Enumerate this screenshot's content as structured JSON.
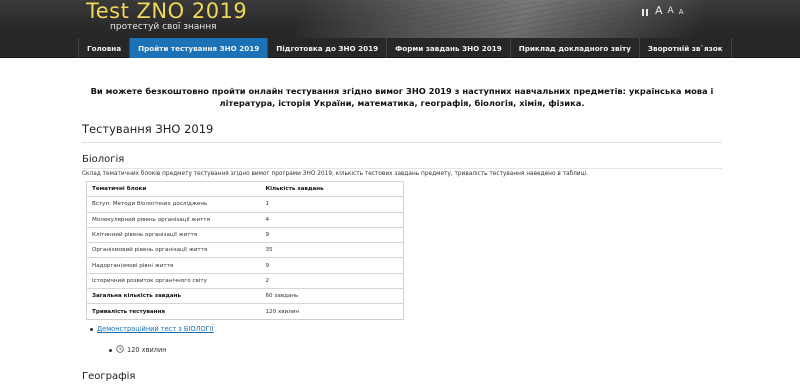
{
  "header": {
    "site_title": "Test ZNO 2019",
    "slogan": "протестуй свої знання",
    "controls": {
      "font_large": "A",
      "font_medium": "A",
      "font_small": "A"
    }
  },
  "nav": {
    "items": [
      {
        "label": "Головна"
      },
      {
        "label": "Пройти тестування ЗНО 2019",
        "active": true
      },
      {
        "label": "Підготовка до ЗНО 2019"
      },
      {
        "label": "Форми завдань ЗНО 2019"
      },
      {
        "label": "Приклад докладного звіту"
      },
      {
        "label": "Зворотній зв`язок"
      }
    ]
  },
  "main": {
    "intro": "Ви можете безкоштовно пройти онлайн тестування згідно вимог ЗНО 2019 з наступних навчальних предметів: українська мова і література, історія України, математика, географія, біологія, хімія, фізика.",
    "page_title": "Тестування ЗНО 2019",
    "sections": [
      {
        "title": "Біологія",
        "description": "Склад тематичних блоків предмету тестування згідно вимог програми ЗНО 2019, кількість тестових завдань предмету, тривалість тестування наведено в таблиці.",
        "table": {
          "headers": [
            "Тематичні блоки",
            "Кількість завдань"
          ],
          "rows": [
            [
              "Вступ. Методи біологічних досліджень",
              "1"
            ],
            [
              "Молекулярний рівень організації життя",
              "4"
            ],
            [
              "Клітинний рівень організації життя",
              "9"
            ],
            [
              "Організмовий рівень організації життя",
              "35"
            ],
            [
              "Надорганізмові рівні життя",
              "9"
            ],
            [
              "Історичний розвиток органічного світу",
              "2"
            ],
            [
              "Загальна кількість завдань",
              "60 завдань"
            ],
            [
              "Тривалість тестування",
              "120 хвилин"
            ]
          ]
        },
        "demo_link": "Демонстраційний тест з БІОЛОГІЇ",
        "duration": "120 хвилин"
      },
      {
        "title": "Географія"
      }
    ]
  },
  "colors": {
    "header_bg": "#2e2e2e",
    "title_yellow": "#f0d75a",
    "nav_active": "#1b72b6",
    "link": "#1a6fb3"
  }
}
